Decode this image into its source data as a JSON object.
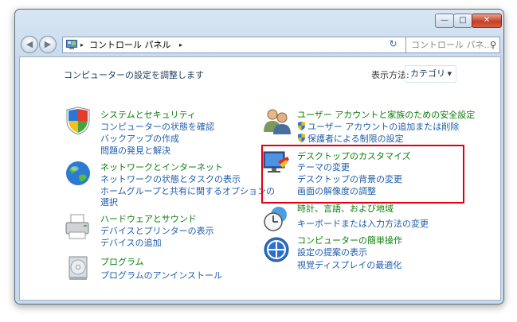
{
  "window": {
    "controls": {
      "minimize": "—",
      "maximize": "□",
      "close": "✕"
    }
  },
  "nav": {
    "back_icon": "◀",
    "forward_icon": "▶",
    "breadcrumb": "コントロール パネル",
    "separator": "▸",
    "dropdown_icon": "▼",
    "refresh_icon": "↻",
    "search_placeholder": "コントロール パネ...",
    "search_icon": "⚲"
  },
  "header": {
    "title": "コンピューターの設定を調整します",
    "view_label": "表示方法:",
    "view_value": "カテゴリ",
    "view_arrow": "▼"
  },
  "left_categories": [
    {
      "title": "システムとセキュリティ",
      "links": [
        "コンピューターの状態を確認",
        "バックアップの作成",
        "問題の発見と解決"
      ]
    },
    {
      "title": "ネットワークとインターネット",
      "links": [
        "ネットワークの状態とタスクの表示",
        "ホームグループと共有に関するオプションの",
        "選択"
      ]
    },
    {
      "title": "ハードウェアとサウンド",
      "links": [
        "デバイスとプリンターの表示",
        "デバイスの追加"
      ]
    },
    {
      "title": "プログラム",
      "links": [
        "プログラムのアンインストール"
      ]
    }
  ],
  "right_categories": [
    {
      "title": "ユーザー アカウントと家族のための安全設定",
      "links": [
        "ユーザー アカウントの追加または削除",
        "保護者による制限の設定"
      ]
    },
    {
      "title": "デスクトップのカスタマイズ",
      "links": [
        "テーマの変更",
        "デスクトップの背景の変更",
        "画面の解像度の調整"
      ]
    },
    {
      "title": "時計、言語、および地域",
      "links": [
        "キーボードまたは入力方法の変更"
      ]
    },
    {
      "title": "コンピューターの簡単操作",
      "links": [
        "設定の提案の表示",
        "視覚ディスプレイの最適化"
      ]
    }
  ],
  "colors": {
    "category_title": "#0b7e0b",
    "link": "#1f5da9",
    "highlight_border": "#e00010"
  }
}
